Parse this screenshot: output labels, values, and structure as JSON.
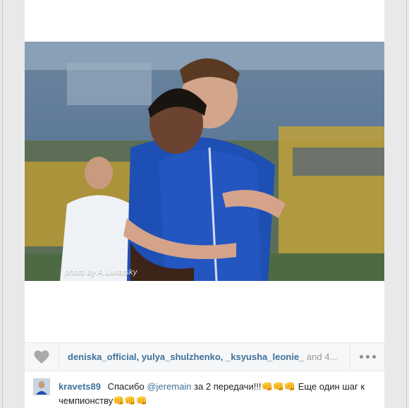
{
  "photo": {
    "credit": "photo by A.Lukatsky"
  },
  "likes": {
    "likers": [
      "deniska_official",
      "yulya_shulzhenko",
      "_ksyusha_leonie_"
    ],
    "and_text": "and 4..."
  },
  "comment": {
    "username": "kravets89",
    "text_before": "Спасибо",
    "mention": "@jeremain",
    "text_after": "за 2 передачи!!!👊👊👊 Еще один шаг к чемпионству👊👊👊"
  },
  "icons": {
    "like": "heart-icon",
    "more": "more-dots-icon"
  },
  "colors": {
    "link": "#3f729b",
    "page_bg": "#e9e9e9",
    "bar_bg": "#f6f7f8",
    "kit_blue": "#1f4fb0"
  }
}
